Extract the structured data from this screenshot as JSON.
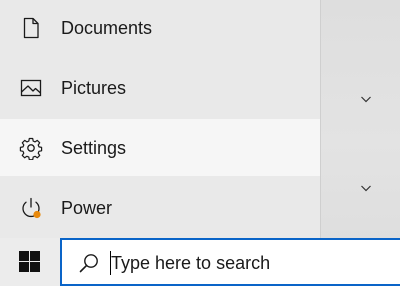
{
  "start_menu": {
    "items": [
      {
        "label": "Documents",
        "icon": "document-icon"
      },
      {
        "label": "Pictures",
        "icon": "pictures-icon"
      },
      {
        "label": "Settings",
        "icon": "gear-icon",
        "selected": true
      },
      {
        "label": "Power",
        "icon": "power-icon",
        "update_dot_color": "#e8890c"
      }
    ]
  },
  "taskbar": {
    "start_icon": "windows-logo-icon",
    "search": {
      "icon": "search-icon",
      "placeholder": "Type here to search",
      "value": "",
      "accent_color": "#0a64c8"
    }
  },
  "right_pane": {
    "icons": [
      "chevron-down-icon",
      "chevron-down-icon"
    ]
  }
}
